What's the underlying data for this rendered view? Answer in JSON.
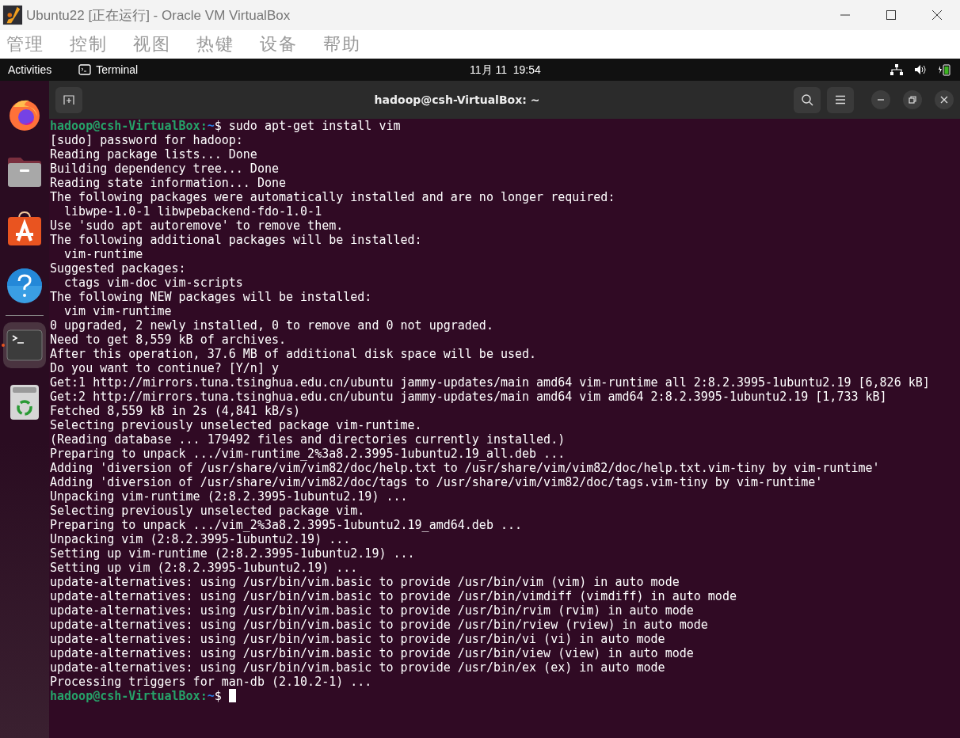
{
  "window": {
    "title": "Ubuntu22 [正在运行] - Oracle VM VirtualBox"
  },
  "menu_bar": [
    "管理",
    "控制",
    "视图",
    "热键",
    "设备",
    "帮助"
  ],
  "top_bar": {
    "activities": "Activities",
    "app": "Terminal",
    "clock": "11月 11  19:54"
  },
  "dock": [
    {
      "kind": "browser",
      "active": false
    },
    {
      "kind": "folder",
      "active": false
    },
    {
      "kind": "store",
      "active": false
    },
    {
      "kind": "help",
      "active": false
    },
    {
      "kind": "separator"
    },
    {
      "kind": "terminal",
      "active": true
    },
    {
      "kind": "trash",
      "active": false
    }
  ],
  "terminal": {
    "title": "hadoop@csh-VirtualBox: ~",
    "lines": [
      {
        "kind": "prompt",
        "user_host": "hadoop@csh-VirtualBox:",
        "path": "~",
        "symbol": "$",
        "command": " sudo apt-get install vim",
        "cursor": false
      },
      {
        "kind": "output",
        "text": "[sudo] password for hadoop:"
      },
      {
        "kind": "output",
        "text": "Reading package lists... Done"
      },
      {
        "kind": "output",
        "text": "Building dependency tree... Done"
      },
      {
        "kind": "output",
        "text": "Reading state information... Done"
      },
      {
        "kind": "output",
        "text": "The following packages were automatically installed and are no longer required:"
      },
      {
        "kind": "output",
        "text": "  libwpe-1.0-1 libwpebackend-fdo-1.0-1"
      },
      {
        "kind": "output",
        "text": "Use 'sudo apt autoremove' to remove them."
      },
      {
        "kind": "output",
        "text": "The following additional packages will be installed:"
      },
      {
        "kind": "output",
        "text": "  vim-runtime"
      },
      {
        "kind": "output",
        "text": "Suggested packages:"
      },
      {
        "kind": "output",
        "text": "  ctags vim-doc vim-scripts"
      },
      {
        "kind": "output",
        "text": "The following NEW packages will be installed:"
      },
      {
        "kind": "output",
        "text": "  vim vim-runtime"
      },
      {
        "kind": "output",
        "text": "0 upgraded, 2 newly installed, 0 to remove and 0 not upgraded."
      },
      {
        "kind": "output",
        "text": "Need to get 8,559 kB of archives."
      },
      {
        "kind": "output",
        "text": "After this operation, 37.6 MB of additional disk space will be used."
      },
      {
        "kind": "output",
        "text": "Do you want to continue? [Y/n] y"
      },
      {
        "kind": "output",
        "text": "Get:1 http://mirrors.tuna.tsinghua.edu.cn/ubuntu jammy-updates/main amd64 vim-runtime all 2:8.2.3995-1ubuntu2.19 [6,826 kB]"
      },
      {
        "kind": "output",
        "text": "Get:2 http://mirrors.tuna.tsinghua.edu.cn/ubuntu jammy-updates/main amd64 vim amd64 2:8.2.3995-1ubuntu2.19 [1,733 kB]"
      },
      {
        "kind": "output",
        "text": "Fetched 8,559 kB in 2s (4,841 kB/s)"
      },
      {
        "kind": "output",
        "text": "Selecting previously unselected package vim-runtime."
      },
      {
        "kind": "output",
        "text": "(Reading database ... 179492 files and directories currently installed.)"
      },
      {
        "kind": "output",
        "text": "Preparing to unpack .../vim-runtime_2%3a8.2.3995-1ubuntu2.19_all.deb ..."
      },
      {
        "kind": "output",
        "text": "Adding 'diversion of /usr/share/vim/vim82/doc/help.txt to /usr/share/vim/vim82/doc/help.txt.vim-tiny by vim-runtime'"
      },
      {
        "kind": "output",
        "text": "Adding 'diversion of /usr/share/vim/vim82/doc/tags to /usr/share/vim/vim82/doc/tags.vim-tiny by vim-runtime'"
      },
      {
        "kind": "output",
        "text": "Unpacking vim-runtime (2:8.2.3995-1ubuntu2.19) ..."
      },
      {
        "kind": "output",
        "text": "Selecting previously unselected package vim."
      },
      {
        "kind": "output",
        "text": "Preparing to unpack .../vim_2%3a8.2.3995-1ubuntu2.19_amd64.deb ..."
      },
      {
        "kind": "output",
        "text": "Unpacking vim (2:8.2.3995-1ubuntu2.19) ..."
      },
      {
        "kind": "output",
        "text": "Setting up vim-runtime (2:8.2.3995-1ubuntu2.19) ..."
      },
      {
        "kind": "output",
        "text": "Setting up vim (2:8.2.3995-1ubuntu2.19) ..."
      },
      {
        "kind": "output",
        "text": "update-alternatives: using /usr/bin/vim.basic to provide /usr/bin/vim (vim) in auto mode"
      },
      {
        "kind": "output",
        "text": "update-alternatives: using /usr/bin/vim.basic to provide /usr/bin/vimdiff (vimdiff) in auto mode"
      },
      {
        "kind": "output",
        "text": "update-alternatives: using /usr/bin/vim.basic to provide /usr/bin/rvim (rvim) in auto mode"
      },
      {
        "kind": "output",
        "text": "update-alternatives: using /usr/bin/vim.basic to provide /usr/bin/rview (rview) in auto mode"
      },
      {
        "kind": "output",
        "text": "update-alternatives: using /usr/bin/vim.basic to provide /usr/bin/vi (vi) in auto mode"
      },
      {
        "kind": "output",
        "text": "update-alternatives: using /usr/bin/vim.basic to provide /usr/bin/view (view) in auto mode"
      },
      {
        "kind": "output",
        "text": "update-alternatives: using /usr/bin/vim.basic to provide /usr/bin/ex (ex) in auto mode"
      },
      {
        "kind": "output",
        "text": "Processing triggers for man-db (2.10.2-1) ..."
      },
      {
        "kind": "prompt",
        "user_host": "hadoop@csh-VirtualBox:",
        "path": "~",
        "symbol": "$",
        "cursor": true
      }
    ]
  }
}
